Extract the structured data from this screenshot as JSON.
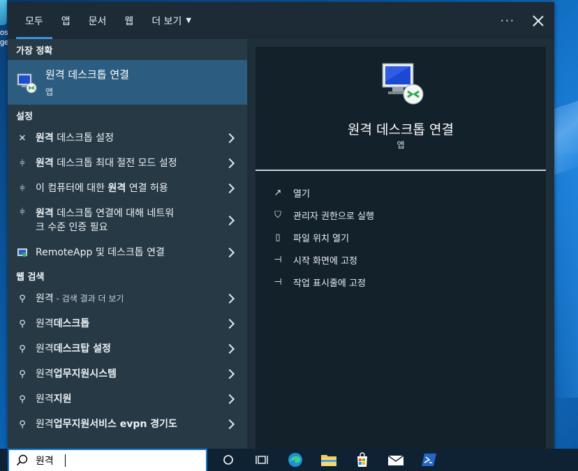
{
  "desktop": {
    "icon_label": "os\nge"
  },
  "tabs": [
    {
      "label": "모두",
      "active": true
    },
    {
      "label": "앱"
    },
    {
      "label": "문서"
    },
    {
      "label": "웹"
    },
    {
      "label": "더 보기"
    }
  ],
  "top_actions": {
    "more": "···"
  },
  "best_match": {
    "header": "가장 정확",
    "title": "원격 데스크톱 연결",
    "subtitle": "앱"
  },
  "settings": {
    "header": "설정",
    "items": [
      {
        "bold": "원격",
        "rest": " 데스크톱 설정"
      },
      {
        "bold": "원격",
        "rest": " 데스크톱 최대 절전 모드 설정"
      },
      {
        "pre": "이 컴퓨터에 대한 ",
        "bold": "원격",
        "rest": " 연결 허용"
      },
      {
        "bold": "원격",
        "rest": " 데스크톱 연결에 대해 네트워",
        "line2": "크 수준 인증 필요"
      },
      {
        "plain": "RemoteApp 및 데스크톱 연결"
      }
    ]
  },
  "web": {
    "header": "웹 검색",
    "items": [
      {
        "pre": "원격",
        "small": " - 검색 결과 더 보기"
      },
      {
        "pre": "원격",
        "bold": "데스크톱"
      },
      {
        "pre": "원격",
        "bold": "데스크탑 설정"
      },
      {
        "pre": "원격",
        "bold": "업무지원시스템"
      },
      {
        "pre": "원격",
        "bold": "지원"
      },
      {
        "pre": "원격",
        "bold": "업무지원서비스 evpn 경기도"
      }
    ]
  },
  "preview": {
    "title": "원격 데스크톱 연결",
    "subtitle": "앱",
    "actions": [
      {
        "icon": "open-icon",
        "label": "열기"
      },
      {
        "icon": "shield-icon",
        "label": "관리자 권한으로 실행"
      },
      {
        "icon": "file-location-icon",
        "label": "파일 위치 열기"
      },
      {
        "icon": "pin-icon",
        "label": "시작 화면에 고정"
      },
      {
        "icon": "pin-icon",
        "label": "작업 표시줄에 고정"
      }
    ]
  },
  "search": {
    "value": "원격"
  },
  "colors": {
    "accent": "#3b95e0",
    "panel": "#263945",
    "preview": "#13212b",
    "selected": "#2c5d80"
  }
}
